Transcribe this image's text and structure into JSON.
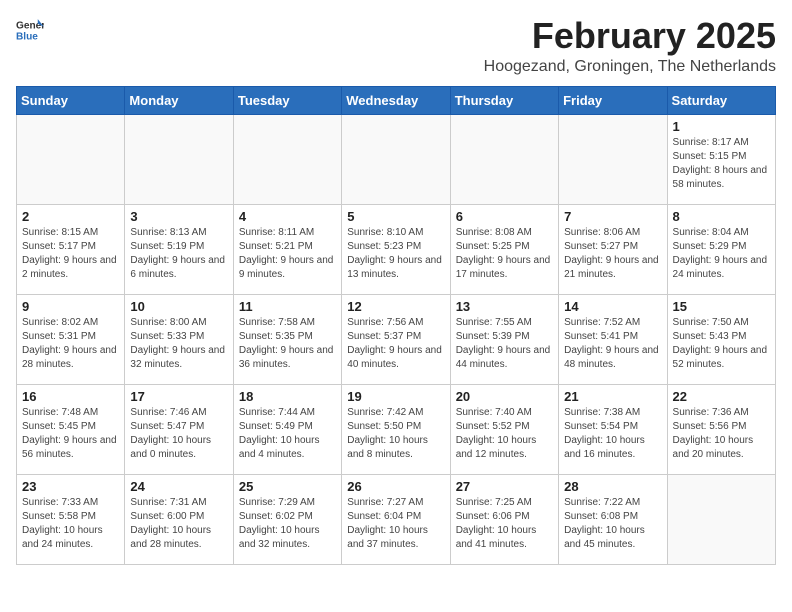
{
  "logo": {
    "general": "General",
    "blue": "Blue"
  },
  "header": {
    "month": "February 2025",
    "location": "Hoogezand, Groningen, The Netherlands"
  },
  "weekdays": [
    "Sunday",
    "Monday",
    "Tuesday",
    "Wednesday",
    "Thursday",
    "Friday",
    "Saturday"
  ],
  "weeks": [
    [
      {
        "day": "",
        "info": ""
      },
      {
        "day": "",
        "info": ""
      },
      {
        "day": "",
        "info": ""
      },
      {
        "day": "",
        "info": ""
      },
      {
        "day": "",
        "info": ""
      },
      {
        "day": "",
        "info": ""
      },
      {
        "day": "1",
        "info": "Sunrise: 8:17 AM\nSunset: 5:15 PM\nDaylight: 8 hours and 58 minutes."
      }
    ],
    [
      {
        "day": "2",
        "info": "Sunrise: 8:15 AM\nSunset: 5:17 PM\nDaylight: 9 hours and 2 minutes."
      },
      {
        "day": "3",
        "info": "Sunrise: 8:13 AM\nSunset: 5:19 PM\nDaylight: 9 hours and 6 minutes."
      },
      {
        "day": "4",
        "info": "Sunrise: 8:11 AM\nSunset: 5:21 PM\nDaylight: 9 hours and 9 minutes."
      },
      {
        "day": "5",
        "info": "Sunrise: 8:10 AM\nSunset: 5:23 PM\nDaylight: 9 hours and 13 minutes."
      },
      {
        "day": "6",
        "info": "Sunrise: 8:08 AM\nSunset: 5:25 PM\nDaylight: 9 hours and 17 minutes."
      },
      {
        "day": "7",
        "info": "Sunrise: 8:06 AM\nSunset: 5:27 PM\nDaylight: 9 hours and 21 minutes."
      },
      {
        "day": "8",
        "info": "Sunrise: 8:04 AM\nSunset: 5:29 PM\nDaylight: 9 hours and 24 minutes."
      }
    ],
    [
      {
        "day": "9",
        "info": "Sunrise: 8:02 AM\nSunset: 5:31 PM\nDaylight: 9 hours and 28 minutes."
      },
      {
        "day": "10",
        "info": "Sunrise: 8:00 AM\nSunset: 5:33 PM\nDaylight: 9 hours and 32 minutes."
      },
      {
        "day": "11",
        "info": "Sunrise: 7:58 AM\nSunset: 5:35 PM\nDaylight: 9 hours and 36 minutes."
      },
      {
        "day": "12",
        "info": "Sunrise: 7:56 AM\nSunset: 5:37 PM\nDaylight: 9 hours and 40 minutes."
      },
      {
        "day": "13",
        "info": "Sunrise: 7:55 AM\nSunset: 5:39 PM\nDaylight: 9 hours and 44 minutes."
      },
      {
        "day": "14",
        "info": "Sunrise: 7:52 AM\nSunset: 5:41 PM\nDaylight: 9 hours and 48 minutes."
      },
      {
        "day": "15",
        "info": "Sunrise: 7:50 AM\nSunset: 5:43 PM\nDaylight: 9 hours and 52 minutes."
      }
    ],
    [
      {
        "day": "16",
        "info": "Sunrise: 7:48 AM\nSunset: 5:45 PM\nDaylight: 9 hours and 56 minutes."
      },
      {
        "day": "17",
        "info": "Sunrise: 7:46 AM\nSunset: 5:47 PM\nDaylight: 10 hours and 0 minutes."
      },
      {
        "day": "18",
        "info": "Sunrise: 7:44 AM\nSunset: 5:49 PM\nDaylight: 10 hours and 4 minutes."
      },
      {
        "day": "19",
        "info": "Sunrise: 7:42 AM\nSunset: 5:50 PM\nDaylight: 10 hours and 8 minutes."
      },
      {
        "day": "20",
        "info": "Sunrise: 7:40 AM\nSunset: 5:52 PM\nDaylight: 10 hours and 12 minutes."
      },
      {
        "day": "21",
        "info": "Sunrise: 7:38 AM\nSunset: 5:54 PM\nDaylight: 10 hours and 16 minutes."
      },
      {
        "day": "22",
        "info": "Sunrise: 7:36 AM\nSunset: 5:56 PM\nDaylight: 10 hours and 20 minutes."
      }
    ],
    [
      {
        "day": "23",
        "info": "Sunrise: 7:33 AM\nSunset: 5:58 PM\nDaylight: 10 hours and 24 minutes."
      },
      {
        "day": "24",
        "info": "Sunrise: 7:31 AM\nSunset: 6:00 PM\nDaylight: 10 hours and 28 minutes."
      },
      {
        "day": "25",
        "info": "Sunrise: 7:29 AM\nSunset: 6:02 PM\nDaylight: 10 hours and 32 minutes."
      },
      {
        "day": "26",
        "info": "Sunrise: 7:27 AM\nSunset: 6:04 PM\nDaylight: 10 hours and 37 minutes."
      },
      {
        "day": "27",
        "info": "Sunrise: 7:25 AM\nSunset: 6:06 PM\nDaylight: 10 hours and 41 minutes."
      },
      {
        "day": "28",
        "info": "Sunrise: 7:22 AM\nSunset: 6:08 PM\nDaylight: 10 hours and 45 minutes."
      },
      {
        "day": "",
        "info": ""
      }
    ]
  ]
}
